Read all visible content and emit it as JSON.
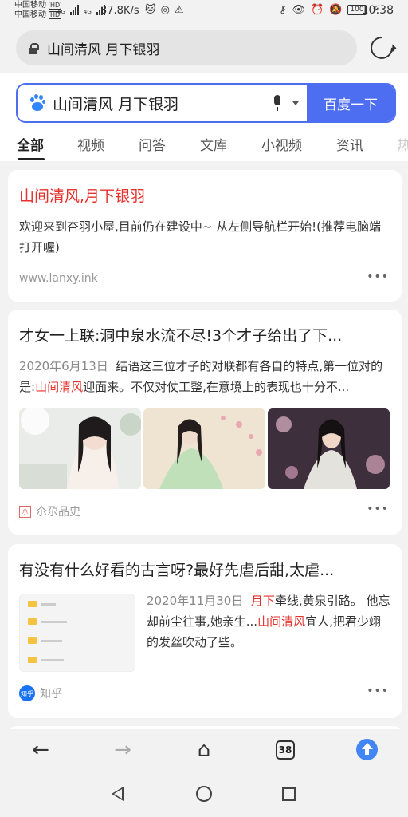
{
  "status_bar": {
    "carrier1": "中国移动",
    "carrier2": "中国移动",
    "hd": "HD",
    "net1": "4G",
    "net2": "4G",
    "speed": "37.8K/s",
    "battery": "100",
    "time": "10:38"
  },
  "address_bar": {
    "url_text": "山间清风 月下银羽"
  },
  "search": {
    "query": "山间清风 月下银羽",
    "button": "百度一下"
  },
  "tabs": [
    {
      "label": "全部",
      "active": true
    },
    {
      "label": "视频"
    },
    {
      "label": "问答"
    },
    {
      "label": "文库"
    },
    {
      "label": "小视频"
    },
    {
      "label": "资讯"
    },
    {
      "label": "热"
    }
  ],
  "results": [
    {
      "title": "山间清风,月下银羽",
      "desc": "欢迎来到杏羽小屋,目前仍在建设中~ 从左侧导航栏开始!(推荐电脑端打开喔)",
      "url": "www.lanxy.ink",
      "more": "•••"
    },
    {
      "title": "才女一上联:洞中泉水流不尽!3个才子给出了下...",
      "date": "2020年6月13日",
      "desc_pre": "结语这三位才子的对联都有各自的特点,第一位对的是:",
      "desc_hl": "山间清风",
      "desc_post": "迎面来。不仅对仗工整,在意境上的表现也十分不...",
      "source": "尒尕品史",
      "more": "•••"
    },
    {
      "title": "有没有什么好看的古言呀?最好先虐后甜,太虐...",
      "date": "2020年11月30日",
      "hl1": "月下",
      "desc_a": "牵线,黄泉引路。 他忘却前尘往事,她亲生...",
      "hl2": "山间清风",
      "desc_b": "宜人,把君少翊的发丝吹动了些。",
      "source": "知乎",
      "more": "•••"
    }
  ],
  "bottom_bar": {
    "tab_count": "38"
  },
  "colors": {
    "accent": "#4e6ef2",
    "highlight": "#e5322d"
  }
}
